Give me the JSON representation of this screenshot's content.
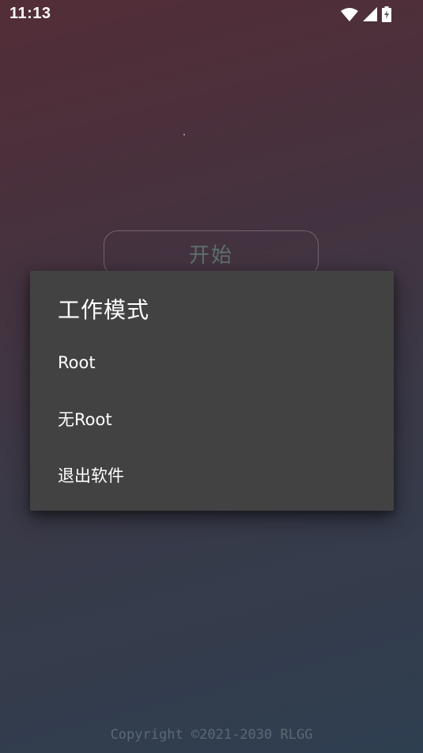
{
  "status_bar": {
    "time": "11:13",
    "icons": [
      "wifi-icon",
      "signal-icon",
      "battery-charging-icon"
    ]
  },
  "main": {
    "start_label": "开始"
  },
  "dialog": {
    "title": "工作模式",
    "items": [
      {
        "label": "Root"
      },
      {
        "label": "无Root"
      },
      {
        "label": "退出软件"
      }
    ]
  },
  "footer": {
    "copyright": "Copyright ©2021-2030 RLGG"
  },
  "colors": {
    "dialog_bg": "#424242",
    "start_text": "#5e6f6e",
    "footer_text": "#5a6a74"
  }
}
